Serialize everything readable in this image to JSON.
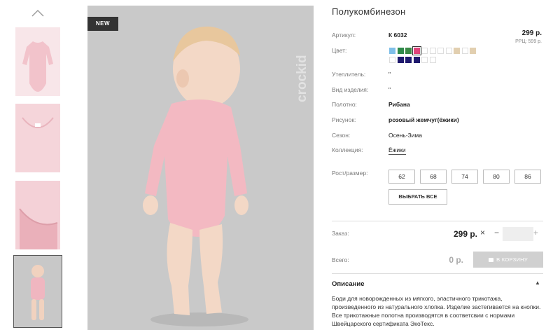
{
  "badge": "NEW",
  "brand_name": "crockid",
  "product": {
    "title": "Полукомбинезон",
    "price": "299 р.",
    "rrp": "РРЦ: 599 р."
  },
  "attributes": {
    "article_label": "Артикул:",
    "article_value": "К 6032",
    "color_label": "Цвет:",
    "insulation_label": "Утеплитель:",
    "insulation_value": "\"",
    "type_label": "Вид изделия:",
    "type_value": "\"",
    "fabric_label": "Полотно:",
    "fabric_value": "Рибана",
    "pattern_label": "Рисунок:",
    "pattern_value": "розовый жемчуг(ёжики)",
    "season_label": "Сезон:",
    "season_value": "Осень-Зима",
    "collection_label": "Коллекция:",
    "collection_value": "Ёжики",
    "size_label": "Рост/размер:"
  },
  "colors_row1": [
    "#7fbfe8",
    "#2f8a4a",
    "#3b8a46",
    "#e0457b",
    "#ffffff",
    "#ffffff",
    "#ffffff",
    "#ffffff",
    "#e2cfb0",
    "#ffffff",
    "#e2cfb0"
  ],
  "colors_row2": [
    "#ffffff",
    "#1f1a6e",
    "#1f1a6e",
    "#1f1a6e",
    "#ffffff",
    "#ffffff"
  ],
  "sizes": [
    "62",
    "68",
    "74",
    "80",
    "86"
  ],
  "select_all": "ВЫБРАТЬ ВСЕ",
  "order": {
    "label": "Заказ:",
    "price": "299 р.",
    "remove": "×",
    "minus": "−",
    "plus": "+"
  },
  "total": {
    "label": "Всего:",
    "value": "0 р."
  },
  "cart_button": "В КОРЗИНУ",
  "description": {
    "title": "Описание",
    "text": "Боди для новорожденных из мягкого, эластичного трикотажа, произведенного из натурального хлопка. Изделие застегивается на кнопки. Все трикотажные полотна производятся в соответсвии с нормами Швейцарского сертификата ЭкоТекс."
  }
}
